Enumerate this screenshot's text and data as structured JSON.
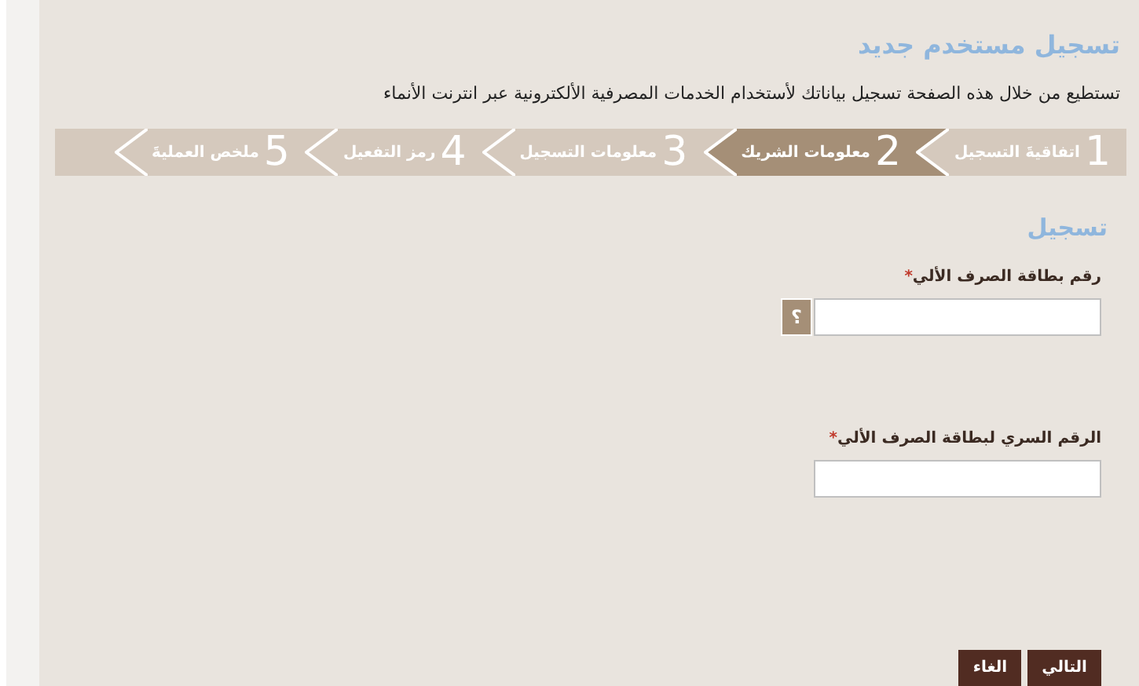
{
  "title": "تسجيل مستخدم جديد",
  "description": "تستطيع من خلال هذه الصفحة تسجيل بياناتك لأستخدام الخدمات المصرفية الألكترونية عبر انترنت الأنماء",
  "steps": [
    {
      "number": "1",
      "label": "اتفاقيةَ التسجيل",
      "selected": false
    },
    {
      "number": "2",
      "label": "معلومات الشريك",
      "selected": true
    },
    {
      "number": "3",
      "label": "معلومات التسجيل",
      "selected": false
    },
    {
      "number": "4",
      "label": "رمز التفعيل",
      "selected": false
    },
    {
      "number": "5",
      "label": "ملخص العمليةَ",
      "selected": false
    }
  ],
  "section_title": "تسجيل",
  "fields": [
    {
      "label": "رقم بطاقة الصرف الألي",
      "required_mark": "*",
      "help": "؟"
    },
    {
      "label": "الرقم السري لبطاقة الصرف الألي",
      "required_mark": "*"
    }
  ],
  "buttons": [
    "التالي",
    "الغاء"
  ]
}
